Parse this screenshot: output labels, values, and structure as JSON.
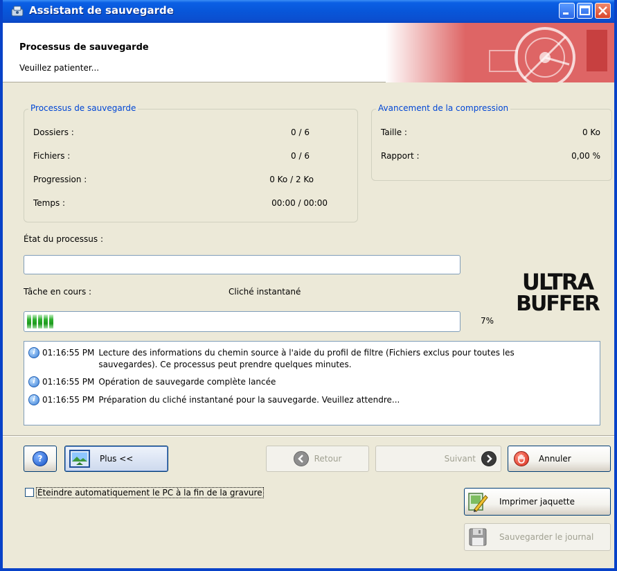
{
  "window": {
    "title": "Assistant de sauvegarde",
    "header_title": "Processus de sauvegarde",
    "header_subtitle": "Veuillez patienter..."
  },
  "process_group": {
    "title": "Processus de sauvegarde",
    "rows": [
      {
        "label": "Dossiers :",
        "value": "0 / 6"
      },
      {
        "label": "Fichiers :",
        "value": "0 / 6"
      },
      {
        "label": "Progression :",
        "value": "0 Ko / 2 Ko"
      },
      {
        "label": "Temps :",
        "value": "00:00 / 00:00"
      }
    ]
  },
  "compression_group": {
    "title": "Avancement de la compression",
    "rows": [
      {
        "label": "Taille :",
        "value": "0 Ko"
      },
      {
        "label": "Rapport :",
        "value": "0,00 %"
      }
    ]
  },
  "status": {
    "state_label": "État du processus :",
    "state_value": "",
    "task_label": "Tâche en cours :",
    "task_value": "Cliché instantané",
    "progress_text": "7%",
    "progress_fraction": 0.07
  },
  "logo": {
    "line1": "ULTRA",
    "line2": "BUFFER"
  },
  "log": [
    {
      "time": "01:16:55 PM",
      "message": "Lecture des informations du chemin source à l'aide du profil de filtre (Fichiers exclus pour toutes les sauvegardes). Ce processus peut prendre quelques minutes."
    },
    {
      "time": "01:16:55 PM",
      "message": "Opération de sauvegarde complète lancée"
    },
    {
      "time": "01:16:55 PM",
      "message": "Préparation du cliché instantané pour la sauvegarde. Veuillez attendre..."
    }
  ],
  "buttons": {
    "help_icon": "question-icon",
    "more": "Plus <<",
    "back": "Retour",
    "next": "Suivant",
    "cancel": "Annuler",
    "print_cover": "Imprimer jaquette",
    "save_log": "Sauvegarder le journal"
  },
  "options": {
    "auto_shutdown_label": "Éteindre automatiquement le PC à la fin de la gravure",
    "auto_shutdown_checked": false
  },
  "colors": {
    "titlebar": "#0856d9",
    "group_title": "#0046d5",
    "progress_green": "#2fb12f",
    "cancel_red": "#d8301f"
  }
}
